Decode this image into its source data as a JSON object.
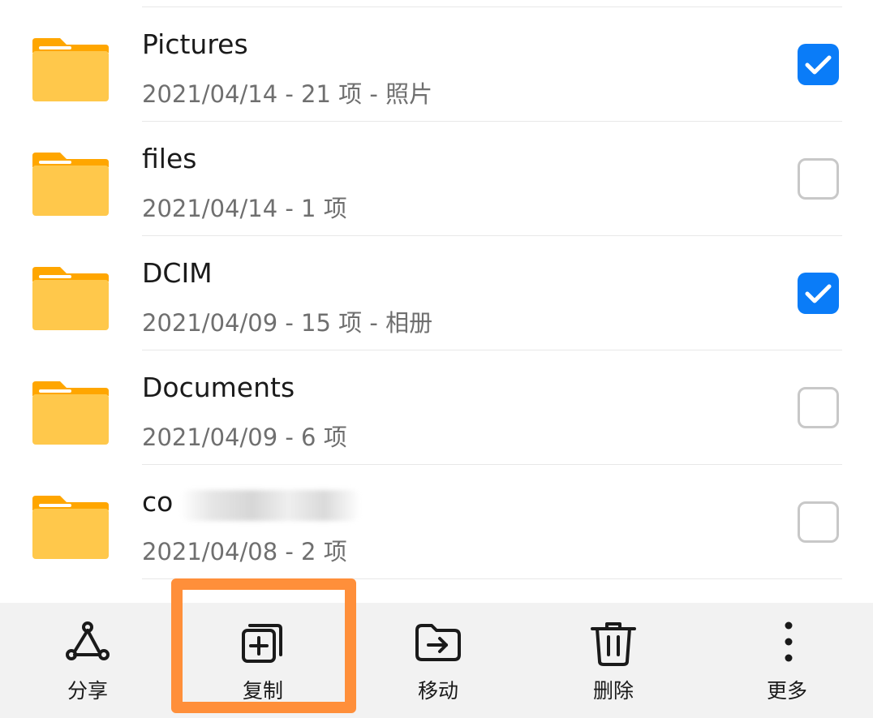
{
  "files": [
    {
      "name": "Pictures",
      "meta": "2021/04/14 - 21 项 - 照片",
      "checked": true
    },
    {
      "name": "files",
      "meta": "2021/04/14 - 1 项",
      "checked": false
    },
    {
      "name": "DCIM",
      "meta": "2021/04/09 - 15 项 - 相册",
      "checked": true
    },
    {
      "name": "Documents",
      "meta": "2021/04/09 - 6 项",
      "checked": false
    },
    {
      "name": "co",
      "meta": "2021/04/08 - 2 项",
      "checked": false
    }
  ],
  "toolbar": {
    "share_label": "分享",
    "copy_label": "复制",
    "move_label": "移动",
    "delete_label": "删除",
    "more_label": "更多"
  },
  "icons": {
    "folder": "folder-icon",
    "share": "share-icon",
    "copy": "copy-icon",
    "move": "move-folder-icon",
    "delete": "trash-icon",
    "more": "more-vertical-icon"
  },
  "colors": {
    "accent": "#0a7cf8",
    "folder": "#ffc84b",
    "folder_tab": "#ffa600",
    "highlight": "#ff8f3a",
    "toolbar_bg": "#f2f2f2"
  }
}
